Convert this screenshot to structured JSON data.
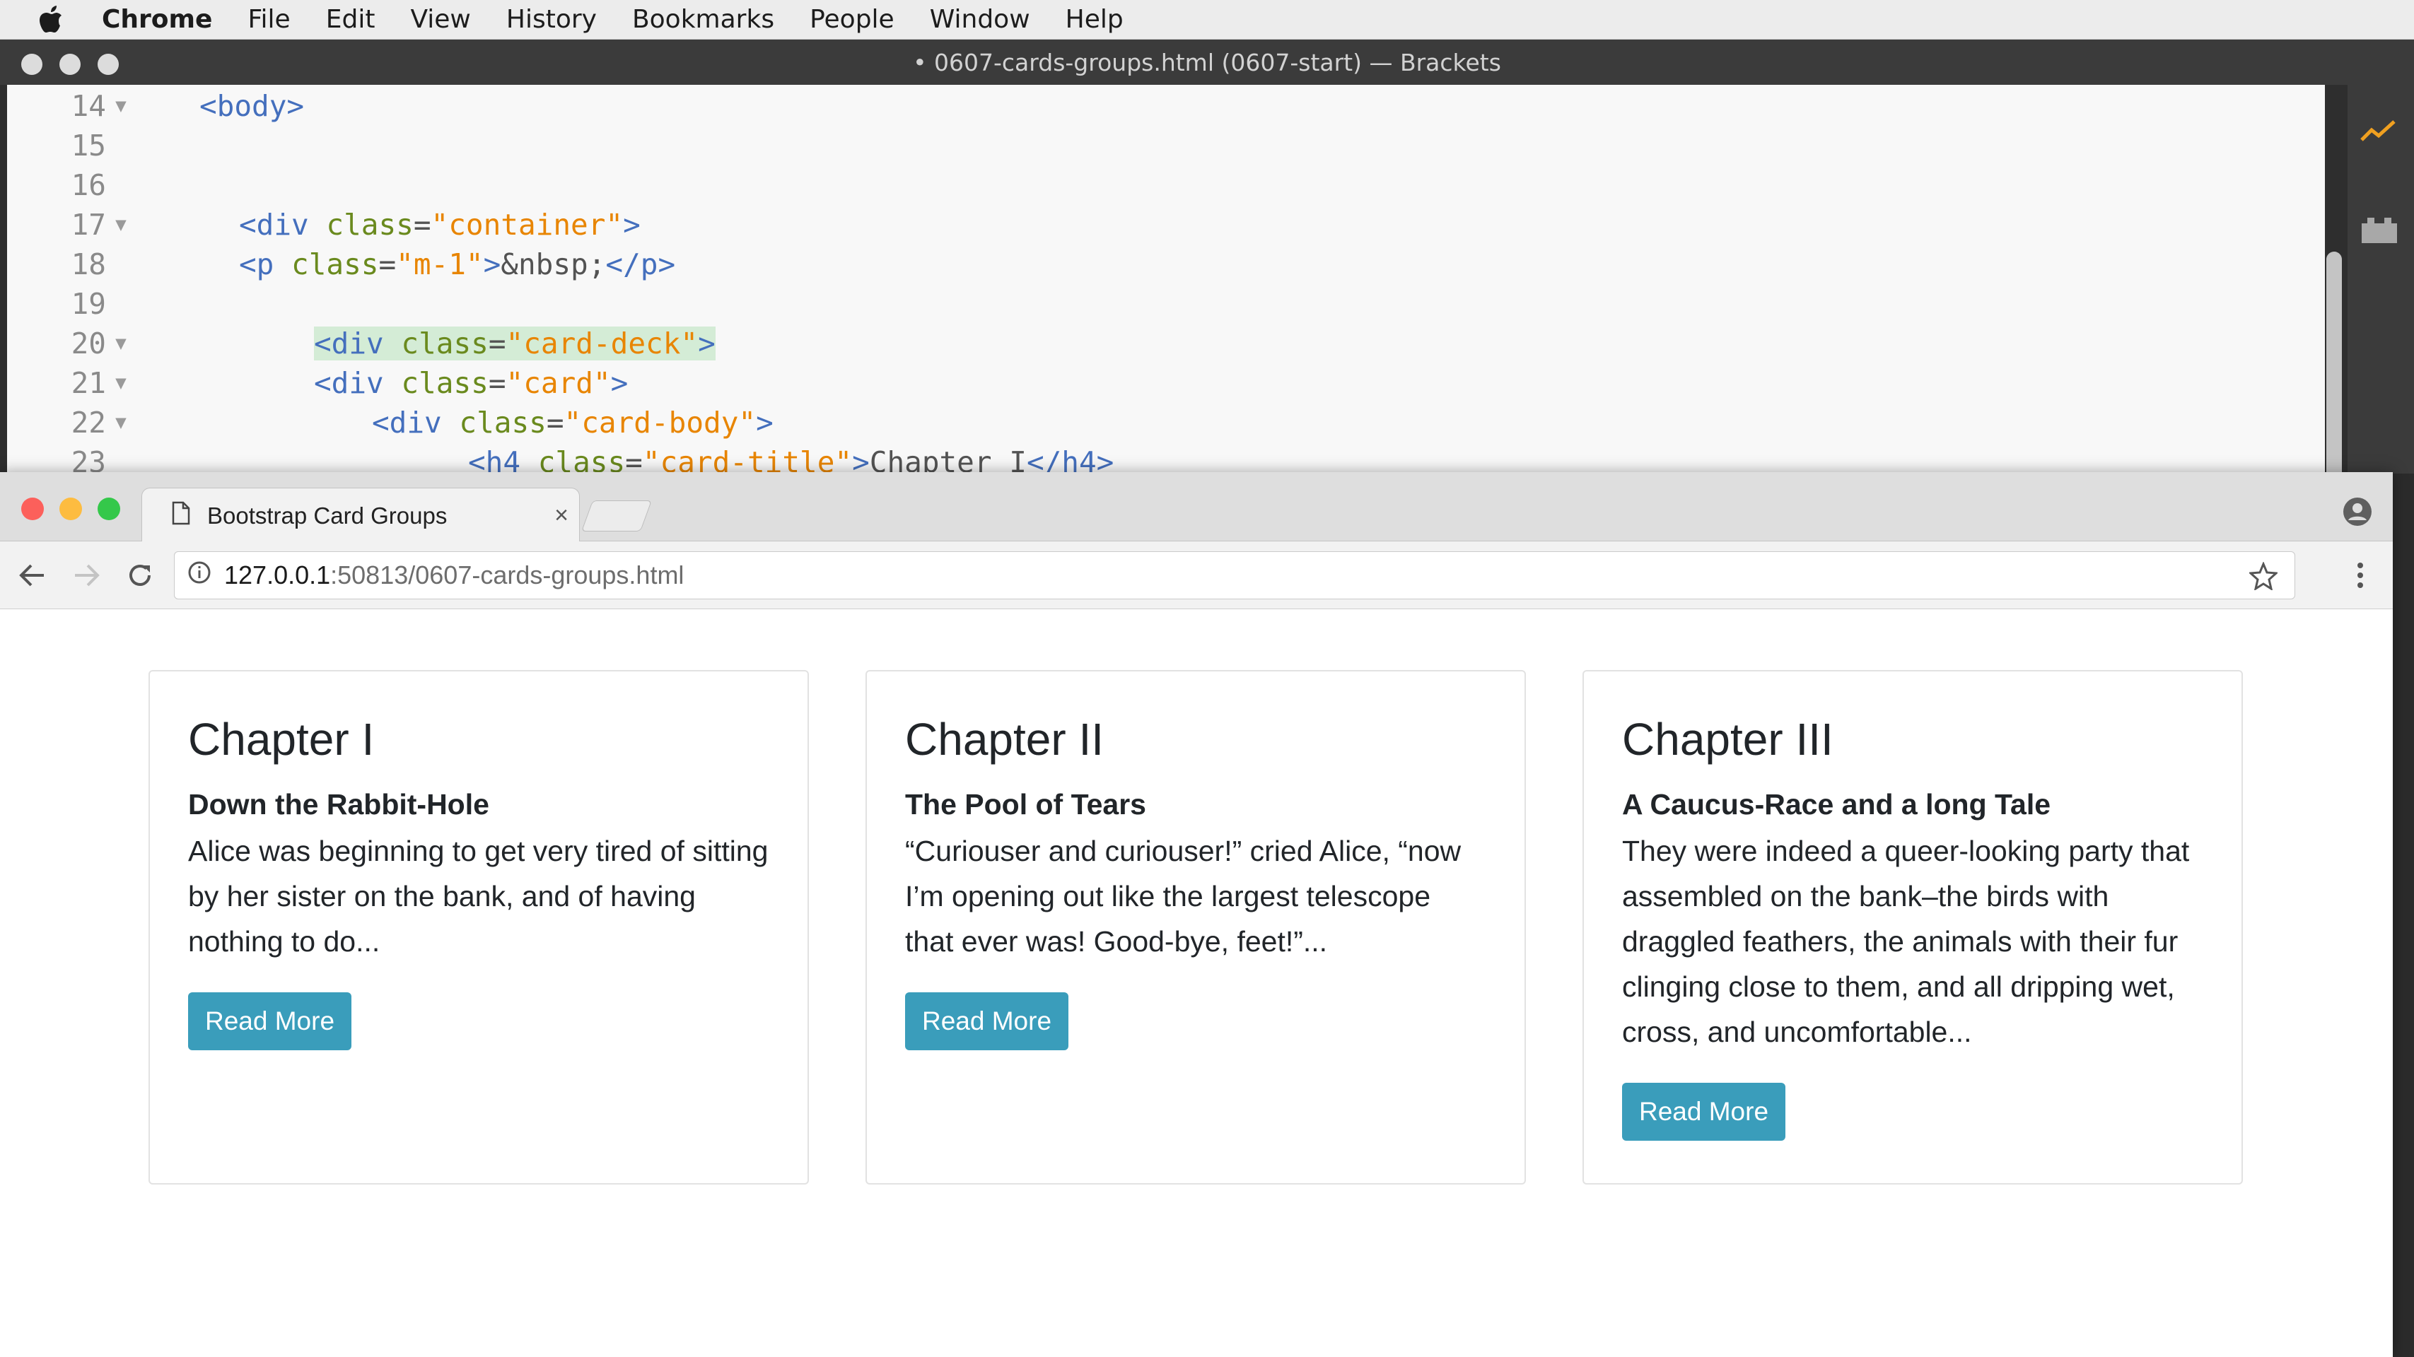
{
  "menubar": {
    "items": [
      "Chrome",
      "File",
      "Edit",
      "View",
      "History",
      "Bookmarks",
      "People",
      "Window",
      "Help"
    ]
  },
  "brackets": {
    "title": "• 0607-cards-groups.html (0607-start) — Brackets",
    "lines": [
      {
        "num": "14",
        "fold": "▼",
        "tag1": "<body>",
        "attr": "",
        "eq": "",
        "val": "",
        "tag2": "",
        "text": "",
        "tag3": ""
      },
      {
        "num": "15",
        "fold": "",
        "tag1": "",
        "attr": "",
        "eq": "",
        "val": "",
        "tag2": "",
        "text": "",
        "tag3": ""
      },
      {
        "num": "16",
        "fold": "",
        "tag1": "",
        "attr": "",
        "eq": "",
        "val": "",
        "tag2": "",
        "text": "",
        "tag3": ""
      },
      {
        "num": "17",
        "fold": "▼",
        "tag1": "<div",
        "attr": " class",
        "eq": "=",
        "val": "\"container\"",
        "tag2": ">",
        "text": "",
        "tag3": ""
      },
      {
        "num": "18",
        "fold": "",
        "tag1": "<p",
        "attr": " class",
        "eq": "=",
        "val": "\"m-1\"",
        "tag2": ">",
        "text": "&nbsp;",
        "tag3": "</p>"
      },
      {
        "num": "19",
        "fold": "",
        "tag1": "",
        "attr": "",
        "eq": "",
        "val": "",
        "tag2": "",
        "text": "",
        "tag3": ""
      },
      {
        "num": "20",
        "fold": "▼",
        "tag1": "<div",
        "attr": " class",
        "eq": "=",
        "val": "\"card-deck\"",
        "tag2": ">",
        "text": "",
        "tag3": ""
      },
      {
        "num": "21",
        "fold": "▼",
        "tag1": "<div",
        "attr": " class",
        "eq": "=",
        "val": "\"card\"",
        "tag2": ">",
        "text": "",
        "tag3": ""
      },
      {
        "num": "22",
        "fold": "▼",
        "tag1": "<div",
        "attr": " class",
        "eq": "=",
        "val": "\"card-body\"",
        "tag2": ">",
        "text": "",
        "tag3": ""
      },
      {
        "num": "23",
        "fold": "",
        "tag1": "<h4",
        "attr": " class",
        "eq": "=",
        "val": "\"card-title\"",
        "tag2": ">",
        "text": "Chapter I",
        "tag3": "</h4>"
      }
    ]
  },
  "chrome": {
    "tab_title": "Bootstrap Card Groups",
    "tab_close": "×",
    "url_host": "127.0.0.1",
    "url_path": ":50813/0607-cards-groups.html"
  },
  "cards": [
    {
      "title": "Chapter I",
      "subtitle": "Down the Rabbit-Hole",
      "text": "Alice was beginning to get very tired of sitting by her sister on the bank, and of having nothing to do...",
      "button": "Read More"
    },
    {
      "title": "Chapter II",
      "subtitle": "The Pool of Tears",
      "text": "“Curiouser and curiouser!” cried Alice, “now I’m opening out like the largest telescope that ever was! Good-bye, feet!”...",
      "button": "Read More"
    },
    {
      "title": "Chapter III",
      "subtitle": "A Caucus-Race and a long Tale",
      "text": "They were indeed a queer-looking party that assembled on the bank–the birds with draggled feathers, the animals with their fur clinging close to them, and all dripping wet, cross, and uncomfortable...",
      "button": "Read More"
    }
  ],
  "colors": {
    "button": "#3a9dbb",
    "tag": "#446fbd",
    "attr": "#6a8a1e",
    "string": "#e88501"
  }
}
